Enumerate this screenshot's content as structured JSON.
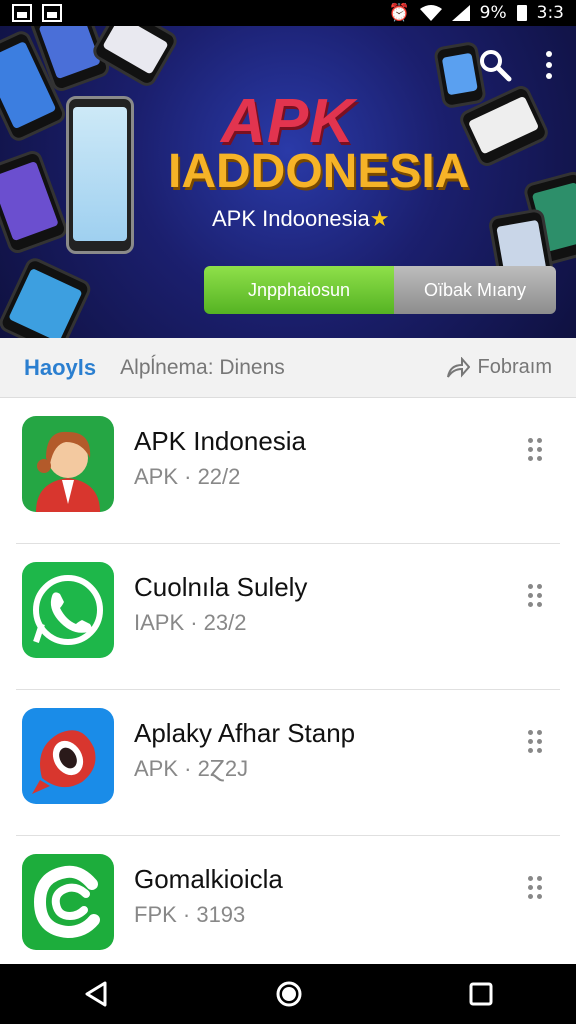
{
  "status_bar": {
    "battery": "9%",
    "time": "3:3"
  },
  "banner": {
    "title_line1": "APK",
    "title_line2": "IADDONESIA",
    "subtitle": "APK Indoonesia",
    "star": "★",
    "primary_button": "Jnpphaiosun",
    "secondary_button": "Oïbak Mıany"
  },
  "tabs": {
    "active": "Haoyls",
    "second": "Alpĺnema: Dinens",
    "right_label": "Fobraım"
  },
  "apps": [
    {
      "name": "APK Indonesia",
      "version": "APK · 22/2",
      "icon": "avatar-icon",
      "color": "#25a644"
    },
    {
      "name": "Cuolnıla Sulely",
      "version": "IAPK · 23/2",
      "icon": "phone-call-icon",
      "color": "#1eb74a"
    },
    {
      "name": "Aplaky Afhar Stanp",
      "version": "APK · 2Ɀ2J",
      "icon": "bird-icon",
      "color": "#1a8ce8"
    },
    {
      "name": "Gomalkioicla",
      "version": "FPK · 3193",
      "icon": "c-logo-icon",
      "color": "#1dad3c"
    }
  ]
}
